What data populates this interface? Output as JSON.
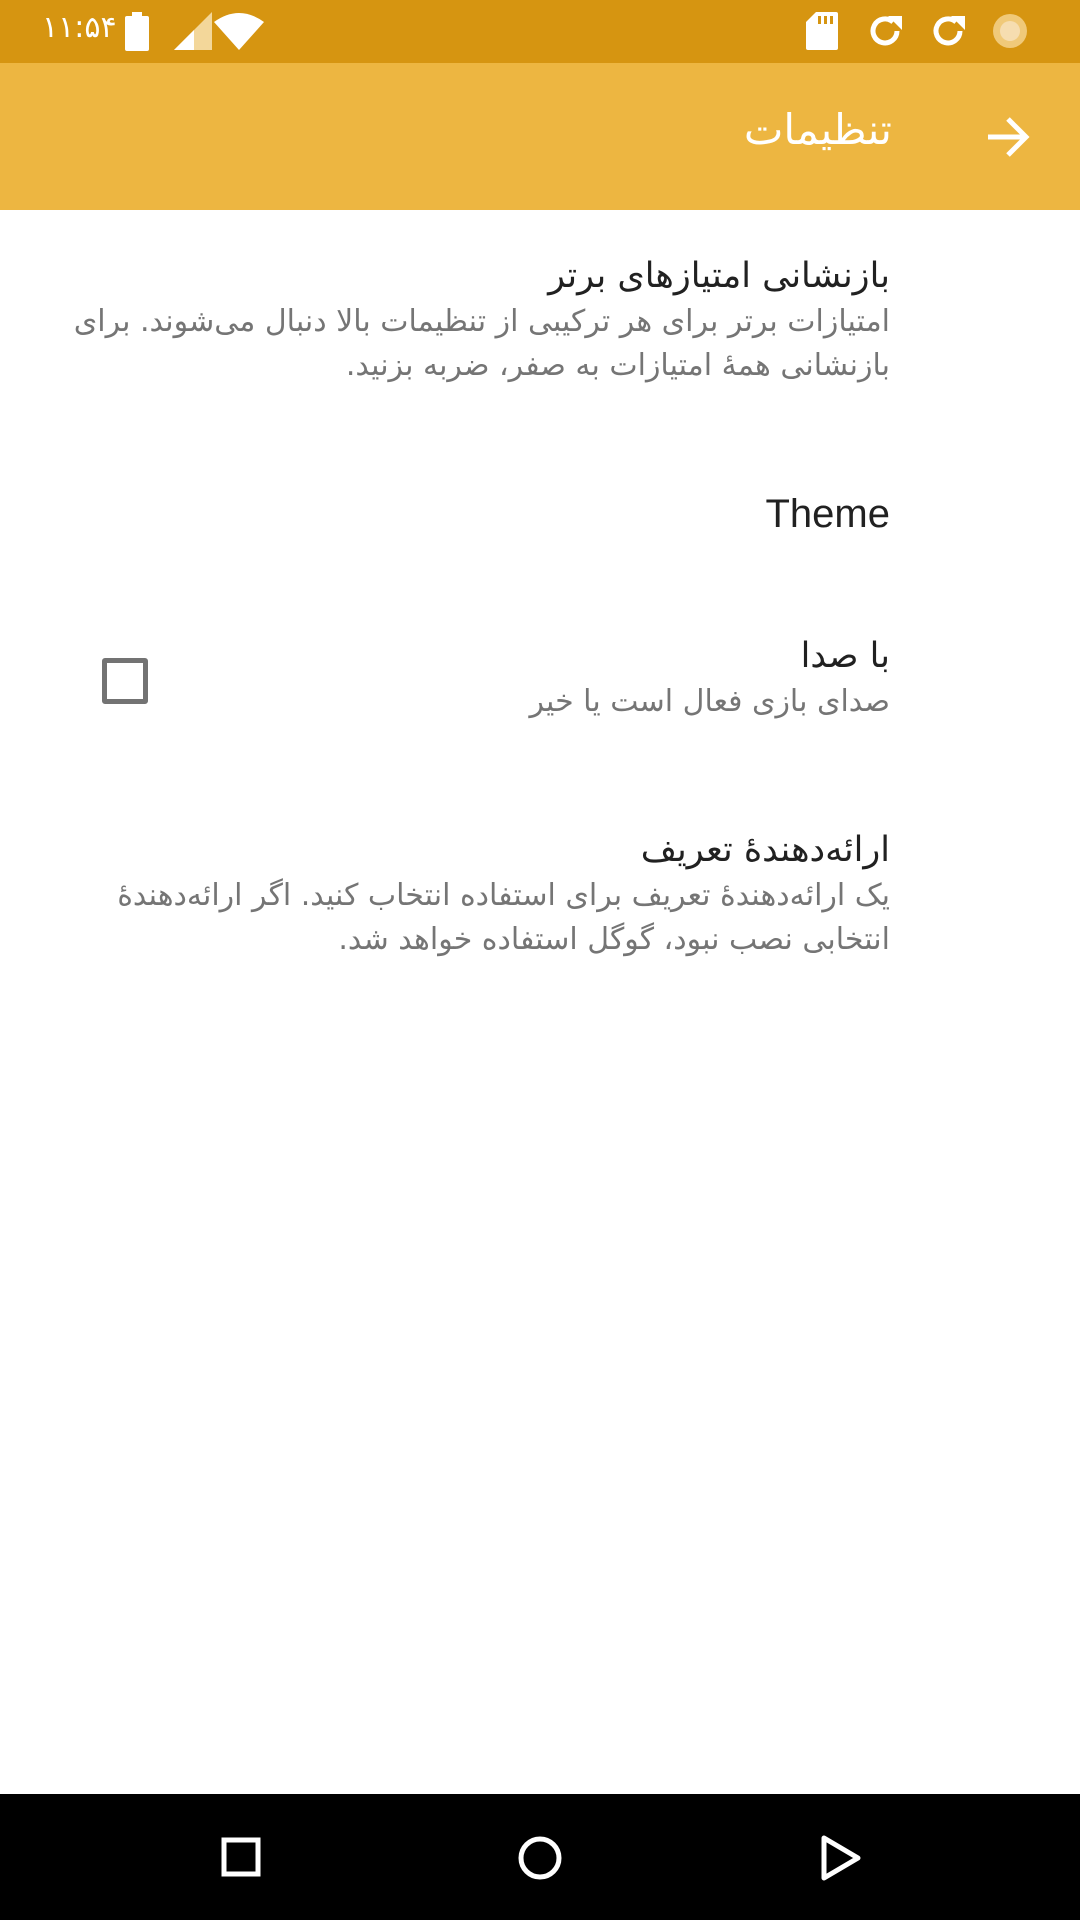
{
  "status_bar": {
    "time": "۱۱:۵۴",
    "icons": [
      "battery-icon",
      "signal-icon",
      "wifi-icon",
      "sd-card-icon",
      "sync-icon",
      "sync-icon",
      "loading-icon"
    ],
    "background": "#d69511"
  },
  "app_bar": {
    "title": "تنظیمات",
    "back_icon": "arrow-forward-icon",
    "background": "#edb641"
  },
  "preferences": {
    "reset_scores": {
      "title": "بازنشانی امتیازهای برتر",
      "summary": "امتیازات برتر برای هر ترکیبی از تنظیمات بالا دنبال می‌شوند. برای بازنشانی همهٔ امتیازات به صفر، ضربه بزنید."
    },
    "theme": {
      "title": "Theme"
    },
    "sound": {
      "title": "با صدا",
      "summary": "صدای بازی فعال است یا خیر",
      "checked": false
    },
    "dictionary_provider": {
      "title": "ارائه‌دهندهٔ تعریف",
      "summary": "یک ارائه‌دهندهٔ تعریف برای استفاده انتخاب کنید. اگر ارائه‌دهندهٔ انتخابی نصب نبود، گوگل استفاده خواهد شد."
    }
  },
  "nav_bar": {
    "icons": [
      "recents-square-icon",
      "home-circle-icon",
      "back-triangle-icon"
    ]
  }
}
